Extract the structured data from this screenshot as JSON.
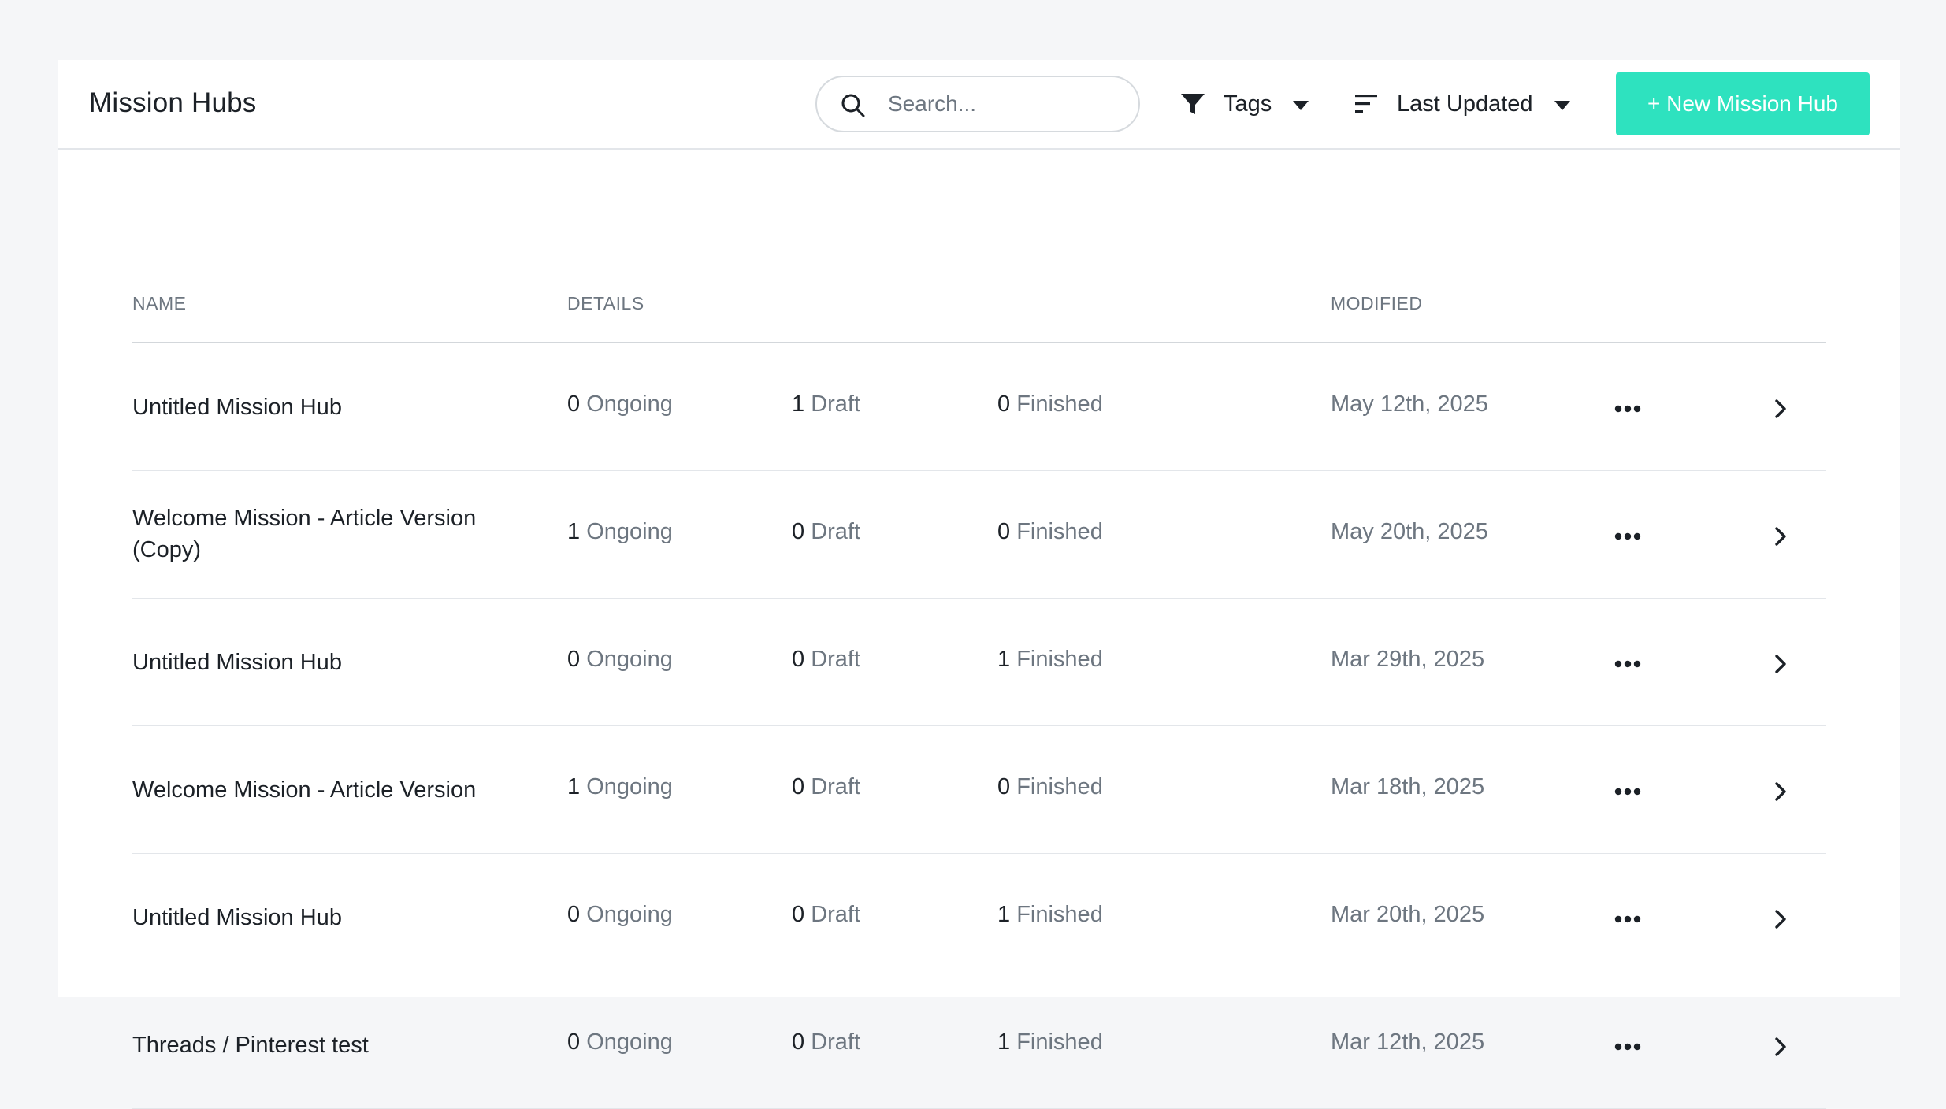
{
  "header": {
    "title": "Mission Hubs",
    "search_placeholder": "Search...",
    "tags_label": "Tags",
    "sort_label": "Last Updated",
    "new_button_label": "+ New Mission Hub",
    "accent_color": "#2ee2bf",
    "icons": [
      "search-icon",
      "filter-icon",
      "sort-icon",
      "caret-down-icon"
    ]
  },
  "table": {
    "columns": {
      "name": "NAME",
      "details": "DETAILS",
      "modified": "MODIFIED"
    },
    "rows": [
      {
        "name_lines": [
          "Untitled Mission Hub"
        ],
        "ongoing": "0",
        "draft": "1",
        "finished": "0",
        "modified": "May 12th, 2025"
      },
      {
        "name_lines": [
          "Welcome Mission - Article Version",
          "(Copy)"
        ],
        "ongoing": "1",
        "draft": "0",
        "finished": "0",
        "modified": "May 20th, 2025"
      },
      {
        "name_lines": [
          "Untitled Mission Hub"
        ],
        "ongoing": "0",
        "draft": "0",
        "finished": "1",
        "modified": "Mar 29th, 2025"
      },
      {
        "name_lines": [
          "Welcome Mission - Article Version"
        ],
        "ongoing": "1",
        "draft": "0",
        "finished": "0",
        "modified": "Mar 18th, 2025"
      },
      {
        "name_lines": [
          "Untitled Mission Hub"
        ],
        "ongoing": "0",
        "draft": "0",
        "finished": "1",
        "modified": "Mar 20th, 2025"
      },
      {
        "name_lines": [
          "Threads / Pinterest test"
        ],
        "ongoing": "0",
        "draft": "0",
        "finished": "1",
        "modified": "Mar 12th, 2025"
      }
    ],
    "labels": {
      "ongoing": "Ongoing",
      "draft": "Draft",
      "finished": "Finished"
    },
    "row_icons": [
      "more-icon",
      "chevron-right-icon"
    ]
  }
}
